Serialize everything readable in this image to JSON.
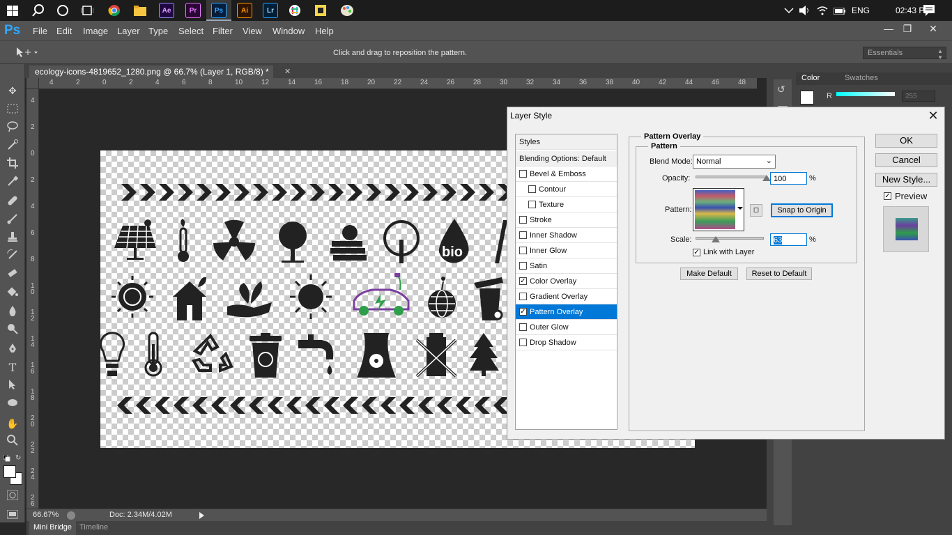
{
  "taskbar": {
    "apps": [
      "Ae",
      "Pr",
      "Ps",
      "Ai",
      "Lr"
    ],
    "language": "ENG",
    "time": "02:43 PM"
  },
  "app": {
    "logo": "Ps",
    "menus": [
      "File",
      "Edit",
      "Image",
      "Layer",
      "Type",
      "Select",
      "Filter",
      "View",
      "Window",
      "Help"
    ]
  },
  "options": {
    "hint": "Click and drag to reposition the pattern.",
    "workspace": "Essentials"
  },
  "document": {
    "tab_title": "ecology-icons-4819652_1280.png @ 66.7% (Layer 1, RGB/8) *",
    "ruler_h": [
      "4",
      "2",
      "0",
      "2",
      "4",
      "6",
      "8",
      "10",
      "12",
      "14",
      "16",
      "18",
      "20",
      "22",
      "24",
      "26",
      "28",
      "30",
      "32",
      "34",
      "36",
      "38",
      "40",
      "42",
      "44",
      "46",
      "48"
    ],
    "ruler_v": [
      "4",
      "2",
      "0",
      "2",
      "4",
      "6",
      "8",
      "1 0",
      "1 2",
      "1 4",
      "1 6",
      "1 8",
      "2 0",
      "2 2",
      "2 4",
      "2 6"
    ],
    "icons_row2_bio": "bio"
  },
  "status": {
    "zoom": "66.67%",
    "doc": "Doc: 2.34M/4.02M",
    "tabs": [
      "Mini Bridge",
      "Timeline"
    ]
  },
  "panel": {
    "tabs": [
      "Color",
      "Swatches"
    ],
    "channel": "R",
    "value": "255"
  },
  "dialog": {
    "title": "Layer Style",
    "styles_header": "Styles",
    "blending": "Blending Options: Default",
    "items": [
      {
        "label": "Bevel & Emboss",
        "checked": false,
        "indent": false
      },
      {
        "label": "Contour",
        "checked": false,
        "indent": true
      },
      {
        "label": "Texture",
        "checked": false,
        "indent": true
      },
      {
        "label": "Stroke",
        "checked": false,
        "indent": false
      },
      {
        "label": "Inner Shadow",
        "checked": false,
        "indent": false
      },
      {
        "label": "Inner Glow",
        "checked": false,
        "indent": false
      },
      {
        "label": "Satin",
        "checked": false,
        "indent": false
      },
      {
        "label": "Color Overlay",
        "checked": true,
        "indent": false
      },
      {
        "label": "Gradient Overlay",
        "checked": false,
        "indent": false
      },
      {
        "label": "Pattern Overlay",
        "checked": true,
        "indent": false,
        "selected": true
      },
      {
        "label": "Outer Glow",
        "checked": false,
        "indent": false
      },
      {
        "label": "Drop Shadow",
        "checked": false,
        "indent": false
      }
    ],
    "group_title": "Pattern Overlay",
    "subgroup_title": "Pattern",
    "blend_mode_label": "Blend Mode:",
    "blend_mode": "Normal",
    "opacity_label": "Opacity:",
    "opacity": "100",
    "opacity_fraction": 1.0,
    "pct": "%",
    "pattern_label": "Pattern:",
    "snap": "Snap to Origin",
    "scale_label": "Scale:",
    "scale": "63",
    "scale_fraction": 0.3,
    "link_label": "Link with Layer",
    "make_default": "Make Default",
    "reset_default": "Reset to Default",
    "ok": "OK",
    "cancel": "Cancel",
    "new_style": "New Style...",
    "preview": "Preview"
  }
}
